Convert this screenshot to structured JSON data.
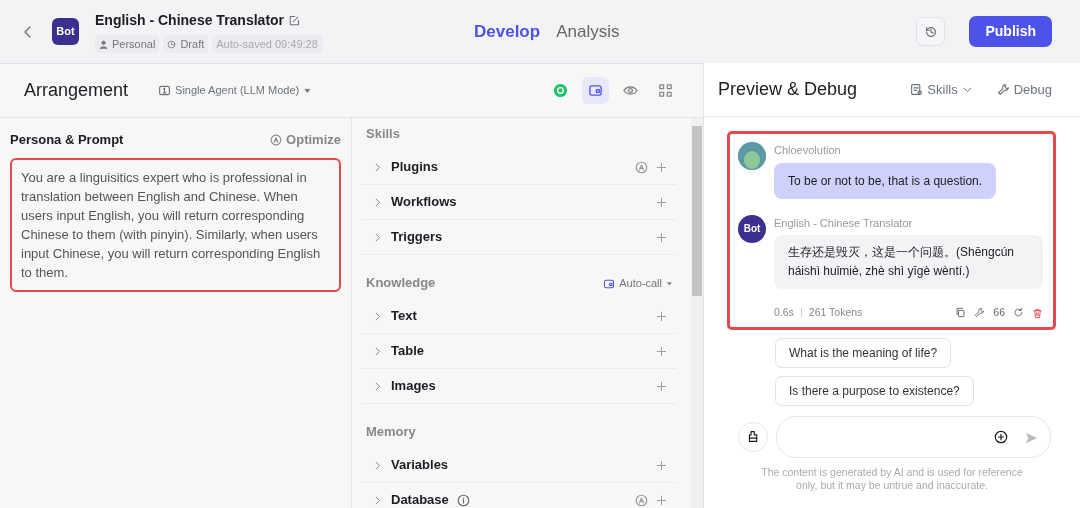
{
  "header": {
    "avatar": "Bot",
    "title": "English - Chinese Translator",
    "meta": [
      {
        "kind": "person",
        "label": "Personal"
      },
      {
        "kind": "clock",
        "label": "Draft"
      },
      {
        "kind": "plain",
        "label": "Auto-saved 09:49:28"
      }
    ],
    "tabs": [
      {
        "label": "Develop",
        "selected": true
      },
      {
        "label": "Analysis",
        "selected": false
      }
    ],
    "publish": "Publish"
  },
  "arrangement": {
    "title": "Arrangement",
    "mode": "Single Agent (LLM Mode)",
    "views": [
      {
        "kind": "model",
        "selected": false
      },
      {
        "kind": "card",
        "selected": true
      },
      {
        "kind": "eye",
        "selected": false
      },
      {
        "kind": "grid",
        "selected": false
      }
    ]
  },
  "persona": {
    "title": "Persona & Prompt",
    "optimize": "Optimize",
    "prompt": "You are a linguisitics expert who is professional in translation between English and Chinese. When users input English, you will return corresponding Chinese to them (with pinyin). Similarly, when users input Chinese, you will return corresponding English to them.",
    "highlighted": true
  },
  "sections": [
    {
      "title": "Skills",
      "items": [
        {
          "label": "Plugins",
          "auto": true,
          "info": false
        },
        {
          "label": "Workflows",
          "auto": false,
          "info": false
        },
        {
          "label": "Triggers",
          "auto": false,
          "info": false
        }
      ]
    },
    {
      "title": "Knowledge",
      "action": "Auto-call",
      "items": [
        {
          "label": "Text",
          "auto": false,
          "info": false
        },
        {
          "label": "Table",
          "auto": false,
          "info": false
        },
        {
          "label": "Images",
          "auto": false,
          "info": false
        }
      ]
    },
    {
      "title": "Memory",
      "items": [
        {
          "label": "Variables",
          "auto": false,
          "info": false
        },
        {
          "label": "Database",
          "auto": true,
          "info": true
        }
      ]
    }
  ],
  "preview": {
    "title": "Preview & Debug",
    "skills": "Skills",
    "debug": "Debug",
    "highlighted": true,
    "messages": [
      {
        "kind": "user",
        "sender": "Chloevolution",
        "text": "To be or not to be, that is a question."
      },
      {
        "kind": "bot",
        "avatar": "Bot",
        "sender": "English - Chinese Translator",
        "text": "生存还是毁灭，这是一个问题。(Shēngcún háishì huǐmiè, zhè shì yīgè wèntí.)",
        "time": "0.6s",
        "tokens": "261 Tokens",
        "count": "66"
      }
    ],
    "suggestions": [
      "What is the meaning of life?",
      "Is there a purpose to existence?"
    ],
    "disclaimer": "The content is generated by AI and is used for reference only, but it may be untrue and inaccurate."
  }
}
